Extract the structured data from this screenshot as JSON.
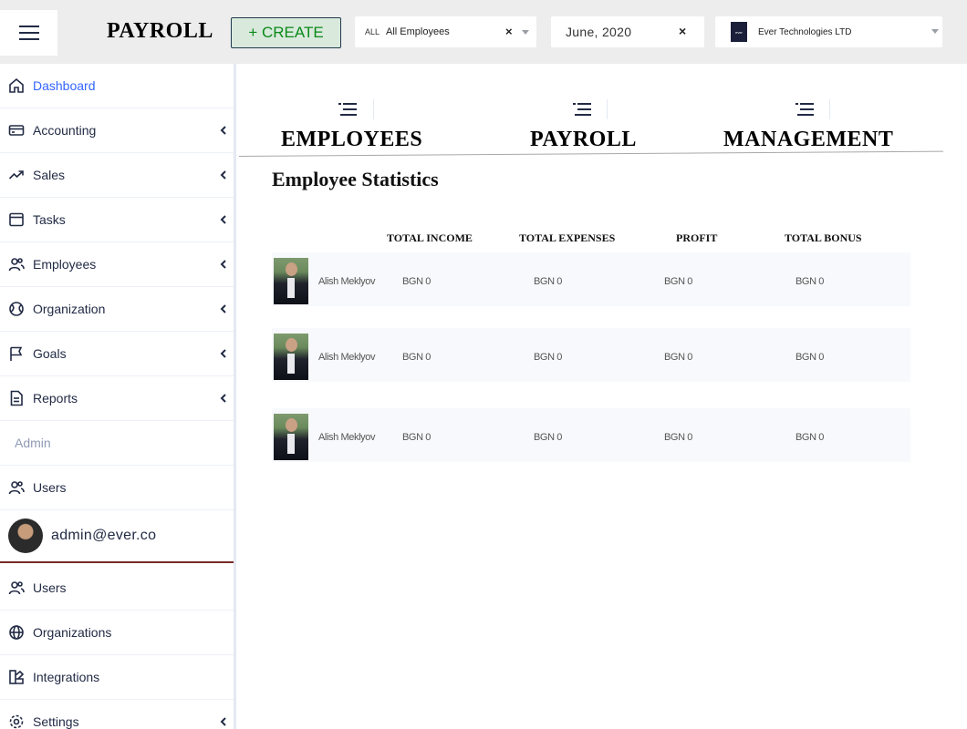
{
  "header": {
    "menu_icon": "menu-icon",
    "title": "PAYROLL",
    "create_label": "+ CREATE",
    "employee_filter": {
      "tag": "ALL",
      "value": "All Employees",
      "clear": "×"
    },
    "date_filter": {
      "value": "June, 2020",
      "clear": "×"
    },
    "organization": {
      "logo_text": "ever",
      "value": "Ever Technologies LTD"
    }
  },
  "sidebar": {
    "items": [
      {
        "label": "Dashboard",
        "icon": "home-icon",
        "active": true,
        "chevron": false
      },
      {
        "label": "Accounting",
        "icon": "credit-card-icon",
        "chevron": true
      },
      {
        "label": "Sales",
        "icon": "trending-up-icon",
        "chevron": true
      },
      {
        "label": "Tasks",
        "icon": "browser-icon",
        "chevron": true
      },
      {
        "label": "Employees",
        "icon": "people-icon",
        "chevron": true
      },
      {
        "label": "Organization",
        "icon": "globe-icon",
        "chevron": true
      },
      {
        "label": "Goals",
        "icon": "flag-icon",
        "chevron": true
      },
      {
        "label": "Reports",
        "icon": "file-text-icon",
        "chevron": true
      }
    ],
    "admin_section": "Admin",
    "admin_items": [
      {
        "label": "Users",
        "icon": "people-icon"
      }
    ],
    "user": {
      "email": "admin@ever.co"
    },
    "bottom_items": [
      {
        "label": "Users",
        "icon": "people-icon",
        "chevron": false
      },
      {
        "label": "Organizations",
        "icon": "globe-icon",
        "chevron": false
      },
      {
        "label": "Integrations",
        "icon": "integrations-icon",
        "chevron": false
      },
      {
        "label": "Settings",
        "icon": "settings-icon",
        "chevron": true
      }
    ]
  },
  "tabs": [
    {
      "label": "EMPLOYEES",
      "icon": "list-icon"
    },
    {
      "label": "PAYROLL",
      "icon": "list-icon"
    },
    {
      "label": "MANAGEMENT",
      "icon": "list-icon"
    }
  ],
  "stats": {
    "title": "Employee Statistics",
    "columns": [
      "TOTAL INCOME",
      "TOTAL EXPENSES",
      "PROFIT",
      "TOTAL BONUS"
    ],
    "rows": [
      {
        "name": "Alish Meklyov",
        "values": [
          "BGN 0",
          "BGN 0",
          "BGN 0",
          "BGN 0"
        ]
      },
      {
        "name": "Alish Meklyov",
        "values": [
          "BGN 0",
          "BGN 0",
          "BGN 0",
          "BGN 0"
        ]
      },
      {
        "name": "Alish Meklyov",
        "values": [
          "BGN 0",
          "BGN 0",
          "BGN 0",
          "BGN 0"
        ]
      }
    ]
  },
  "colors": {
    "accent": "#3366ff",
    "create_text": "#0a8a18",
    "create_bg": "#d9e9dc",
    "header_bg": "#ededed",
    "row_bg": "#f7f9fc"
  }
}
